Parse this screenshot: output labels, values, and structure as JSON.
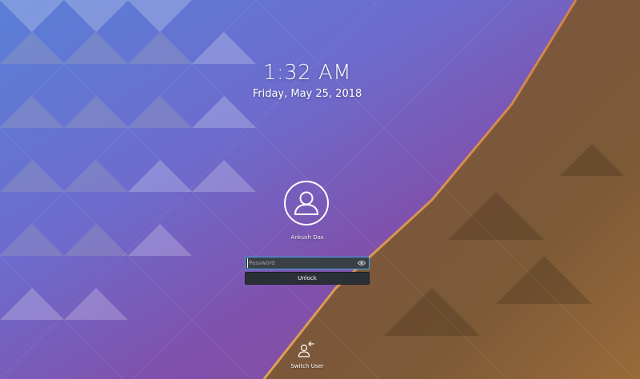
{
  "lockscreen": {
    "time": "1:32 AM",
    "date": "Friday, May 25, 2018",
    "user": {
      "name": "Ankush Das",
      "avatar_icon": "user-silhouette-icon"
    },
    "password": {
      "placeholder": "Password",
      "value": "",
      "reveal_icon": "eye-icon"
    },
    "unlock_label": "Unlock",
    "switch_user": {
      "label": "Switch User",
      "icon": "switch-user-icon"
    }
  },
  "colors": {
    "accent": "#3daee9",
    "field_bg": "#3b3f46",
    "button_bg": "#2b3037",
    "wallpaper_blue": "#5f89d8",
    "wallpaper_purple": "#7d55b0",
    "wallpaper_brown": "#7a5a3a"
  }
}
